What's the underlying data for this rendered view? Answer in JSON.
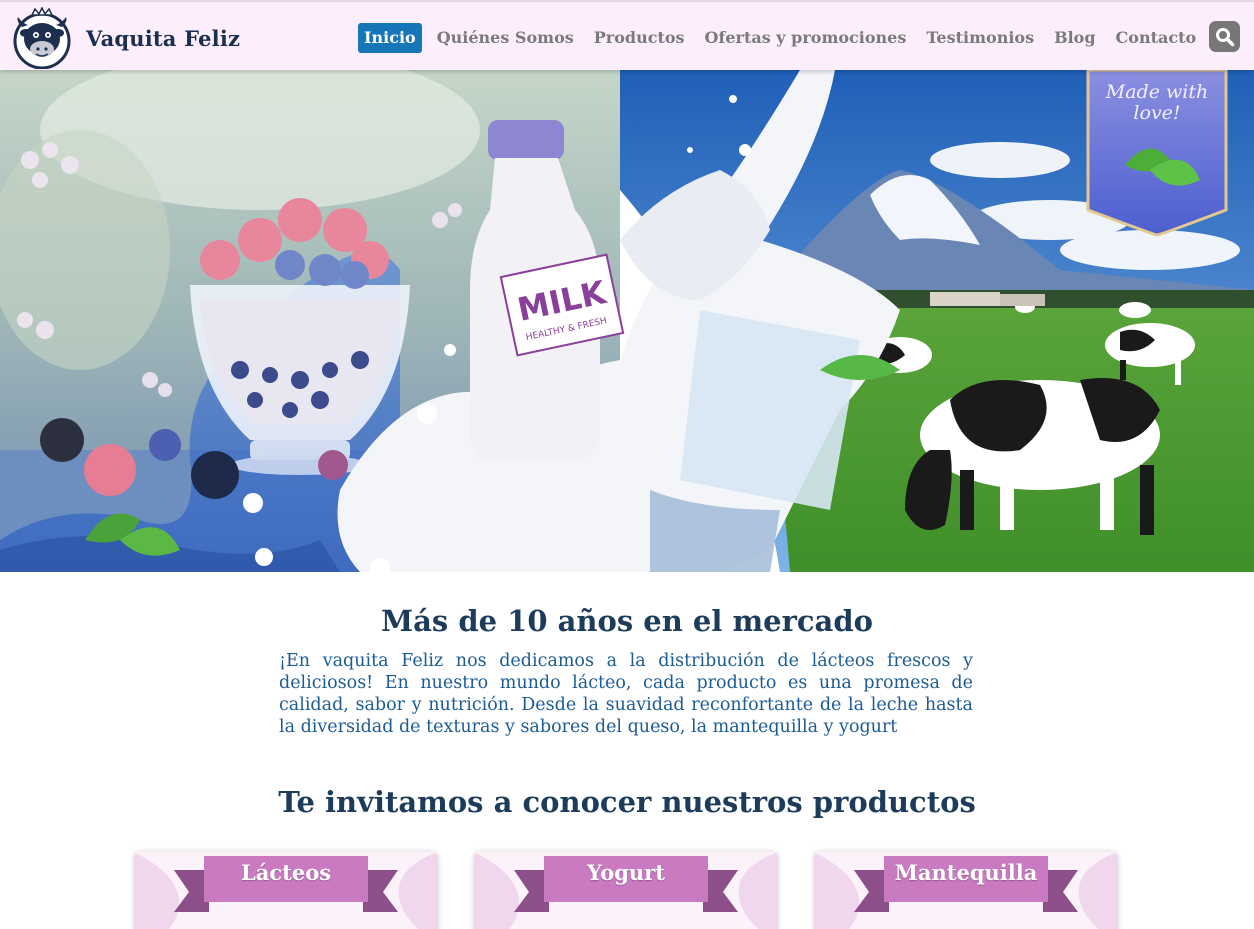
{
  "brand": {
    "name": "Vaquita Feliz"
  },
  "nav": {
    "items": [
      {
        "label": "Inicio",
        "active": true
      },
      {
        "label": "Quiénes Somos",
        "active": false
      },
      {
        "label": "Productos",
        "active": false
      },
      {
        "label": "Ofertas y promociones",
        "active": false
      },
      {
        "label": "Testimonios",
        "active": false
      },
      {
        "label": "Blog",
        "active": false
      },
      {
        "label": "Contacto",
        "active": false
      }
    ],
    "search_icon": "search-icon",
    "active_color": "#1676b7"
  },
  "hero": {
    "badge_text_line1": "Made with",
    "badge_text_line2": "love!",
    "bottle_label": "MILK",
    "bottle_sublabel": "HEALTHY & FRESH"
  },
  "about": {
    "title": "Más de 10 años en el mercado",
    "text": "¡En vaquita Feliz nos dedicamos a la distribución de lácteos frescos y deliciosos! En nuestro mundo lácteo, cada producto es una promesa de calidad, sabor y nutrición. Desde la suavidad reconfortante de la leche hasta la diversidad de texturas y sabores del queso, la mantequilla y yogurt"
  },
  "products": {
    "title": "Te invitamos a conocer nuestros productos",
    "cards": [
      {
        "label": "Lácteos"
      },
      {
        "label": "Yogurt"
      },
      {
        "label": "Mantequilla"
      }
    ]
  },
  "colors": {
    "navbar_bg": "#fdeefc",
    "heading": "#1d3c5c",
    "body_text": "#1c5b94",
    "ribbon": "#c97ac0",
    "ribbon_dark": "#8d4f8a"
  }
}
